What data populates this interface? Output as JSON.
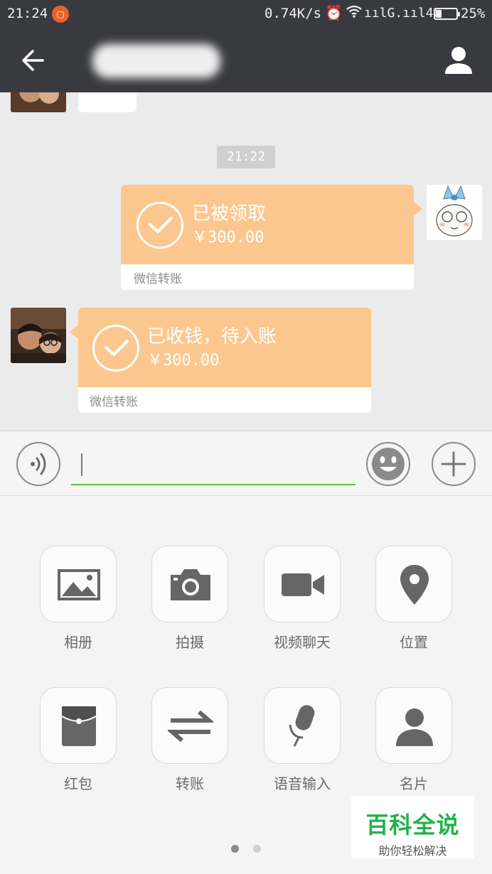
{
  "status_bar": {
    "time": "21:24",
    "network_speed": "0.74K/s",
    "signal": "ıılG.ııl4G",
    "battery_percent": "25%",
    "battery_level": 0.25
  },
  "title_bar": {
    "contact_name": ""
  },
  "chat": {
    "timestamp": "21:22",
    "messages": [
      {
        "side": "right",
        "status": "已被领取",
        "amount": "￥300.00",
        "label": "微信转账"
      },
      {
        "side": "left",
        "status": "已收钱，待入账",
        "amount": "￥300.00",
        "label": "微信转账"
      }
    ]
  },
  "input": {
    "value": "",
    "placeholder": ""
  },
  "tools": [
    {
      "label": "相册",
      "icon": "album-icon"
    },
    {
      "label": "拍摄",
      "icon": "camera-icon"
    },
    {
      "label": "视频聊天",
      "icon": "video-icon"
    },
    {
      "label": "位置",
      "icon": "location-icon"
    },
    {
      "label": "红包",
      "icon": "red-packet-icon"
    },
    {
      "label": "转账",
      "icon": "transfer-icon"
    },
    {
      "label": "语音输入",
      "icon": "microphone-icon"
    },
    {
      "label": "名片",
      "icon": "contact-card-icon"
    }
  ],
  "pager": {
    "pages": 2,
    "active": 1
  },
  "watermark": {
    "title": "百科全说",
    "subtitle": "助你轻松解决"
  },
  "colors": {
    "bar": "#393a3f",
    "transfer_orange": "#fcc78f",
    "input_underline": "#5fbf3d",
    "watermark_green": "#22b14c"
  }
}
